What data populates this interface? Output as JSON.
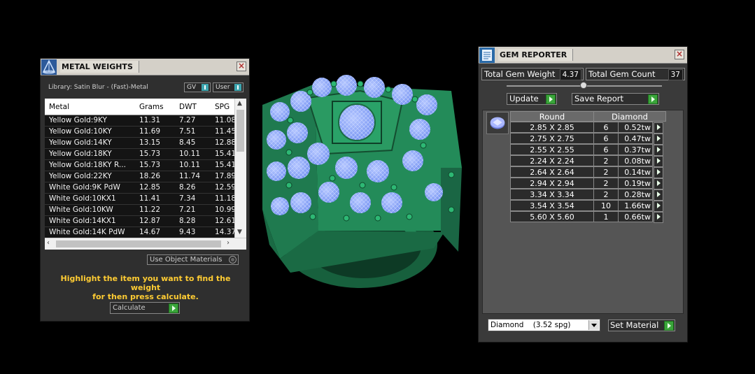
{
  "metal_panel": {
    "title": "METAL WEIGHTS",
    "library": "Library: Satin Blur - (Fast)-Metal",
    "toggle_gv": "GV",
    "toggle_user": "User",
    "columns": [
      "Metal",
      "Grams",
      "DWT",
      "SPG"
    ],
    "rows": [
      [
        "Yellow Gold:9KY",
        "11.31",
        "7.27",
        "11.08"
      ],
      [
        "Yellow Gold:10KY",
        "11.69",
        "7.51",
        "11.45"
      ],
      [
        "Yellow Gold:14KY",
        "13.15",
        "8.45",
        "12.88"
      ],
      [
        "Yellow Gold:18KY",
        "15.73",
        "10.11",
        "15.41"
      ],
      [
        "Yellow Gold:18KY R...",
        "15.73",
        "10.11",
        "15.41"
      ],
      [
        "Yellow Gold:22KY",
        "18.26",
        "11.74",
        "17.89"
      ],
      [
        "White Gold:9K PdW",
        "12.85",
        "8.26",
        "12.59"
      ],
      [
        "White Gold:10KX1",
        "11.41",
        "7.34",
        "11.18"
      ],
      [
        "White Gold:10KW",
        "11.22",
        "7.21",
        "10.99"
      ],
      [
        "White Gold:14KX1",
        "12.87",
        "8.28",
        "12.61"
      ],
      [
        "White Gold:14K PdW",
        "14.67",
        "9.43",
        "14.37"
      ]
    ],
    "use_object_materials": "Use Object Materials",
    "hint_line1": "Highlight the item you want to find the weight",
    "hint_line2": "for then press calculate.",
    "calculate_label": "Calculate"
  },
  "gem_panel": {
    "title": "GEM REPORTER",
    "total_weight_label": "Total Gem Weight",
    "total_weight_value": "4.37",
    "total_count_label": "Total Gem Count",
    "total_count_value": "37",
    "update_label": "Update",
    "save_report_label": "Save Report",
    "col_shape": "Round",
    "col_material": "Diamond",
    "rows": [
      [
        "2.85 X 2.85",
        "6",
        "0.52tw"
      ],
      [
        "2.75 X 2.75",
        "6",
        "0.47tw"
      ],
      [
        "2.55 X 2.55",
        "6",
        "0.37tw"
      ],
      [
        "2.24 X 2.24",
        "2",
        "0.08tw"
      ],
      [
        "2.64 X 2.64",
        "2",
        "0.14tw"
      ],
      [
        "2.94 X 2.94",
        "2",
        "0.19tw"
      ],
      [
        "3.34 X 3.34",
        "2",
        "0.28tw"
      ],
      [
        "3.54 X 3.54",
        "10",
        "1.66tw"
      ],
      [
        "5.60 X 5.60",
        "1",
        "0.66tw"
      ]
    ],
    "material_select": "Diamond    (3.52 spg)",
    "set_material_label": "Set Material"
  },
  "icons": {
    "metal_title_icon": "pyramid-icon",
    "gem_title_icon": "report-icon",
    "gem_shape_icon": "round-gem-icon",
    "close_icon": "close-icon"
  },
  "colors": {
    "ring_green": "#1e7a4e",
    "gem_blue": "#8aa6ff",
    "hint_yellow": "#ffcc33",
    "go_button_green": "#3aa53a"
  }
}
